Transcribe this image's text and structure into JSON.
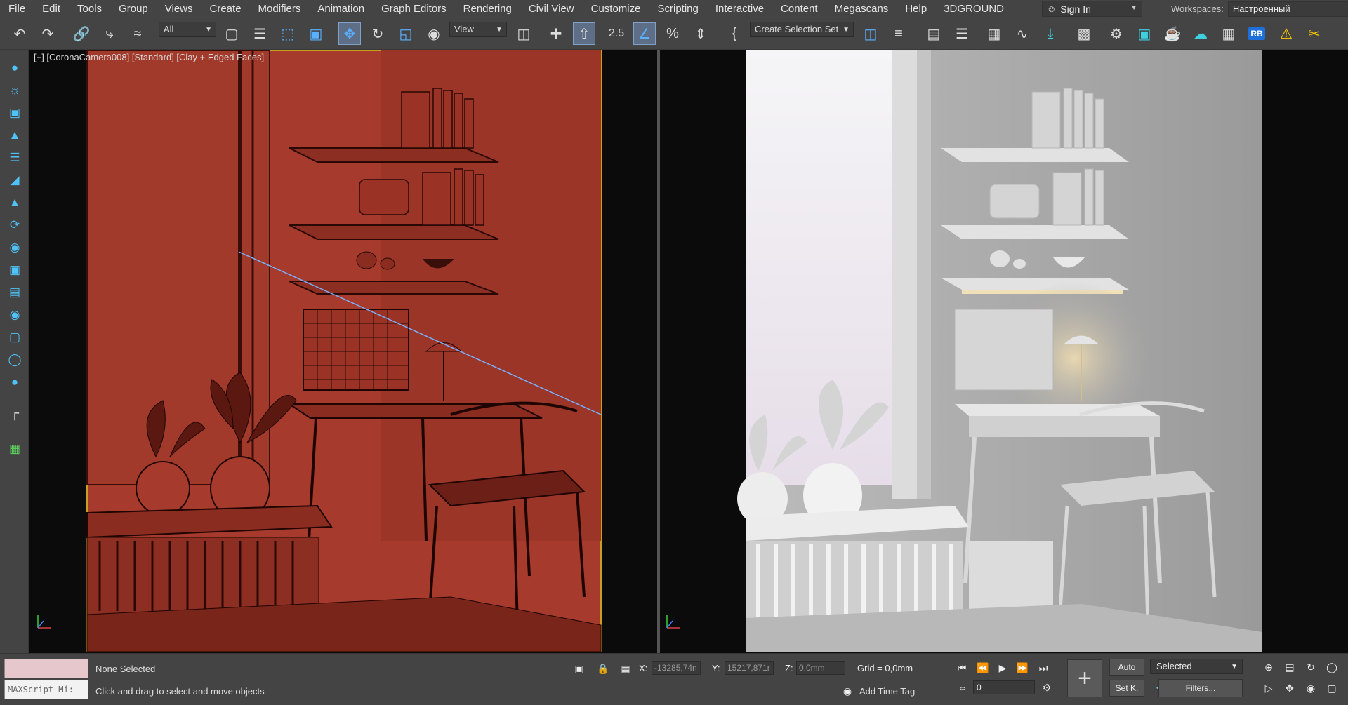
{
  "menu": [
    "File",
    "Edit",
    "Tools",
    "Group",
    "Views",
    "Create",
    "Modifiers",
    "Animation",
    "Graph Editors",
    "Rendering",
    "Civil View",
    "Customize",
    "Scripting",
    "Interactive",
    "Content",
    "Megascans",
    "Help",
    "3DGROUND"
  ],
  "account": {
    "sign_in": "Sign In"
  },
  "workspaces": {
    "label": "Workspaces:",
    "value": "Настроенный"
  },
  "toolbar": {
    "filter_select": "All",
    "ref_coord_select": "View",
    "snap_angle_label": "2.5",
    "selection_set_select": "Create Selection Set",
    "rb_label": "RB"
  },
  "viewport": {
    "label": "[+] [CoronaCamera008] [Standard] [Clay + Edged Faces]",
    "left_mode": "clay-wireframe",
    "right_mode": "clay-render",
    "border_color": "#c8a020"
  },
  "status": {
    "maxscript": "MAXScript Mi:",
    "selection": "None Selected",
    "prompt": "Click and drag to select and move objects",
    "x_label": "X:",
    "x_value": "-13285,74n",
    "y_label": "Y:",
    "y_value": "15217,871r",
    "z_label": "Z:",
    "z_value": "0,0mm",
    "grid": "Grid = 0,0mm",
    "time_tag": "Add Time Tag",
    "frame": "0",
    "auto_key": "Auto",
    "set_key": "Set K.",
    "key_filter_select": "Selected",
    "filters": "Filters..."
  },
  "colors": {
    "accent": "#4fc3f7",
    "swatch": "#e6c8cc",
    "clay_red": "#a63a2c"
  }
}
